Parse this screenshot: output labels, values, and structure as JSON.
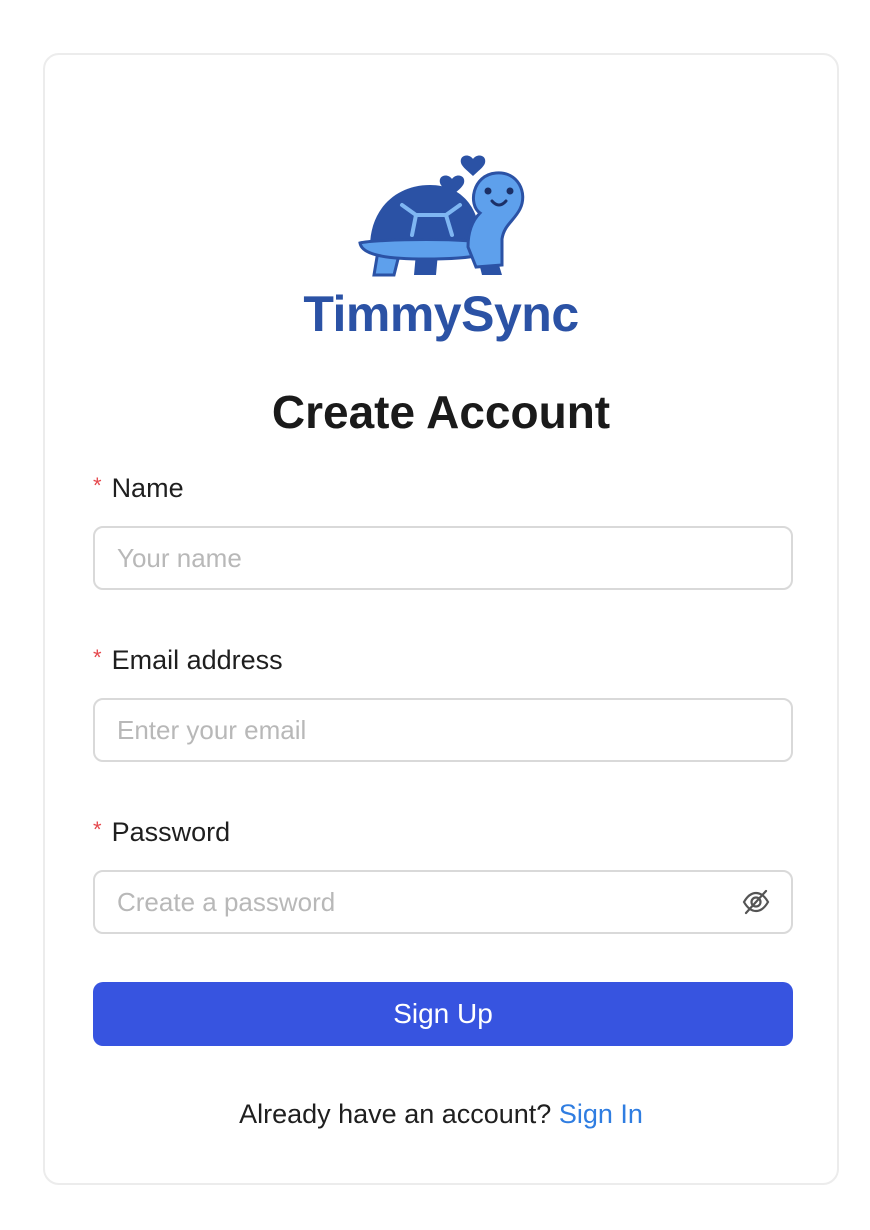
{
  "brand": {
    "name": "TimmySync",
    "logo_icon": "turtle-logo-icon",
    "color": "#2b52a5"
  },
  "form": {
    "title": "Create Account",
    "required_marker": "*",
    "name": {
      "label": "Name",
      "placeholder": "Your name",
      "value": ""
    },
    "email": {
      "label": "Email address",
      "placeholder": "Enter your email",
      "value": ""
    },
    "password": {
      "label": "Password",
      "placeholder": "Create a password",
      "value": "",
      "visibility_icon": "eye-off-icon"
    },
    "submit_label": "Sign Up",
    "submit_color": "#3754e0"
  },
  "footer": {
    "prompt": "Already have an account?",
    "link_label": "Sign In",
    "link_color": "#2f7de1"
  }
}
